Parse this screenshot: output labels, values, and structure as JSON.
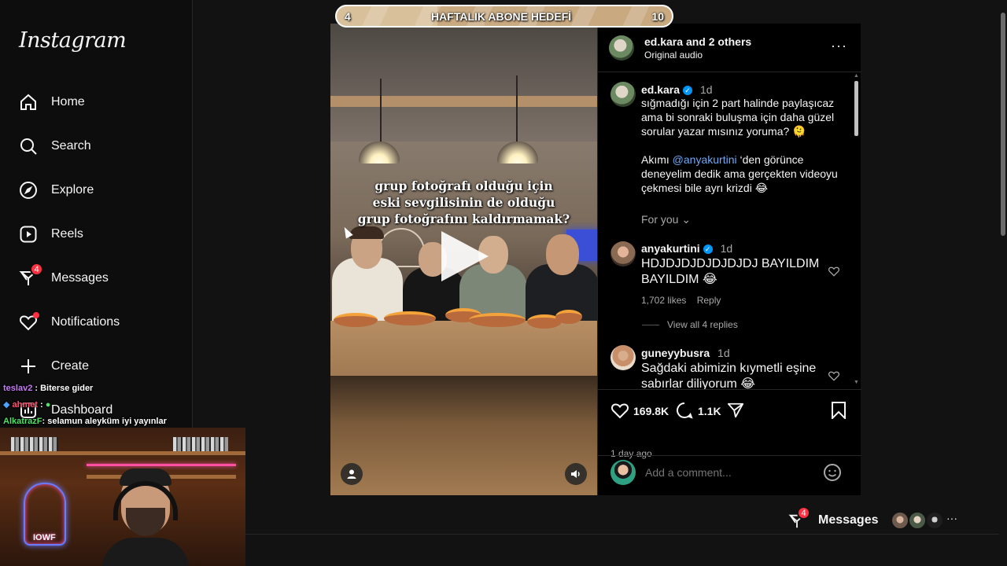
{
  "sidebar": {
    "logo": "Instagram",
    "items": [
      {
        "label": "Home",
        "icon": "home-icon"
      },
      {
        "label": "Search",
        "icon": "search-icon"
      },
      {
        "label": "Explore",
        "icon": "compass-icon"
      },
      {
        "label": "Reels",
        "icon": "reels-icon"
      },
      {
        "label": "Messages",
        "icon": "messenger-icon",
        "badge": "4"
      },
      {
        "label": "Notifications",
        "icon": "heart-icon"
      },
      {
        "label": "Create",
        "icon": "plus-icon"
      },
      {
        "label": "Dashboard",
        "icon": "dashboard-icon"
      }
    ]
  },
  "chat": [
    {
      "user": "teslav2",
      "message": ": Biterse gider"
    },
    {
      "user": "ahmet",
      "message": ":"
    },
    {
      "user": "AlkatrazF",
      "message": ": selamun aleyküm iyi yayınlar"
    }
  ],
  "webcam": {
    "neon_logo_text": "IOWF"
  },
  "goal_bar": {
    "start": "4",
    "title": "HAFTALIK ABONE HEDEFİ",
    "end": "10"
  },
  "video": {
    "caption": [
      "grup fotoğrafı olduğu için",
      "eski sevgilisinin de olduğu",
      "grup fotoğrafını kaldırmamak?"
    ]
  },
  "post_header": {
    "user": "ed.kara",
    "and_others": "and 2 others",
    "audio": "Original audio"
  },
  "caption": {
    "user": "ed.kara",
    "time": "1d",
    "text1": "sığmadığı için 2 part halinde paylaşıcaz ama bi sonraki buluşma için daha güzel sorular yazar mısınız yoruma? 🫠",
    "text2_before": "Akımı ",
    "mention": "@anyakurtini",
    "text2_after": " ‘den görünce deneyelim dedik ama gerçekten videoyu çekmesi bile ayrı krizdi 😂",
    "for_you": "For you"
  },
  "comments": [
    {
      "user": "anyakurtini",
      "time": "1d",
      "text": "HDJDJDJDJDJDJDJ BAYILDIM BAYILDIM 😂",
      "likes": "1,702 likes",
      "reply": "Reply",
      "view_replies": "View all 4 replies"
    },
    {
      "user": "guneyybusra",
      "time": "1d",
      "text": "Sağdaki abimizin kıymetli eşine sabırlar diliyorum 😂"
    }
  ],
  "actions": {
    "likes": "169.8K",
    "comments": "1.1K",
    "posted": "1 day ago"
  },
  "add_comment": {
    "placeholder": "Add a comment..."
  },
  "floating_messages": {
    "label": "Messages",
    "badge": "4"
  },
  "colors": {
    "background": "#121212",
    "accent": "#0095f6",
    "badge": "#ff3040"
  }
}
